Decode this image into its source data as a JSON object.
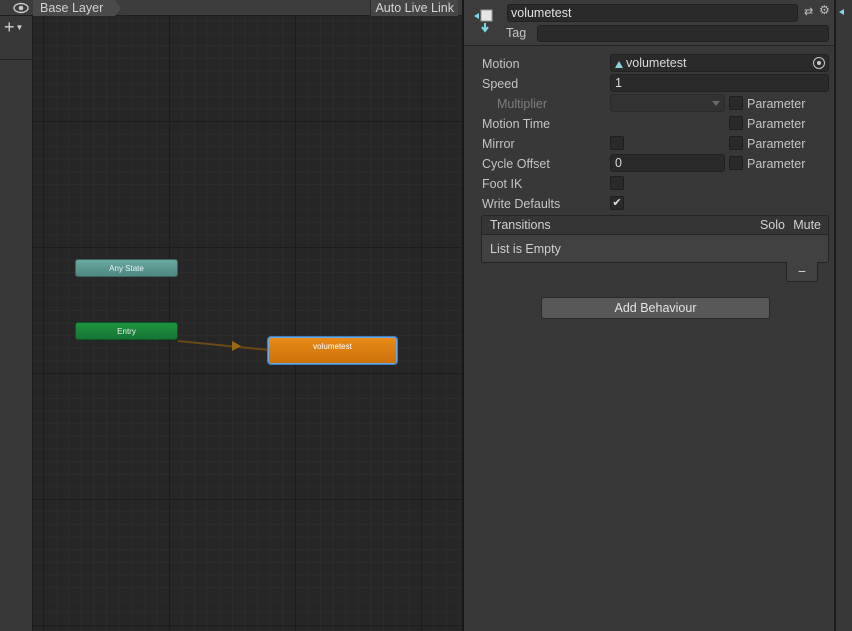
{
  "animator": {
    "breadcrumb": "Base Layer",
    "auto_live_link": "Auto Live Link",
    "add_layer_glyph": "+",
    "states": {
      "any_state": "Any State",
      "entry": "Entry",
      "default_state": "volumetest"
    }
  },
  "inspector": {
    "state_name": "volumetest",
    "tag_label": "Tag",
    "tag_value": "",
    "fields": {
      "motion_label": "Motion",
      "motion_value": "volumetest",
      "speed_label": "Speed",
      "speed_value": "1",
      "multiplier_label": "Multiplier",
      "motion_time_label": "Motion Time",
      "mirror_label": "Mirror",
      "cycle_offset_label": "Cycle Offset",
      "cycle_offset_value": "0",
      "foot_ik_label": "Foot IK",
      "write_defaults_label": "Write Defaults",
      "parameter_label": "Parameter"
    },
    "checks": {
      "multiplier_param": false,
      "motion_time_param": false,
      "mirror": false,
      "mirror_param": false,
      "cycle_offset_param": false,
      "foot_ik": false,
      "write_defaults": true
    },
    "transitions": {
      "title": "Transitions",
      "solo": "Solo",
      "mute": "Mute",
      "empty": "List is Empty",
      "remove_glyph": "−"
    },
    "add_behaviour": "Add Behaviour"
  },
  "colors": {
    "accent_selection": "#3f7fc0",
    "default_state": "#e88b17",
    "entry_state": "#1f9440",
    "any_state": "#6aa8a0"
  }
}
